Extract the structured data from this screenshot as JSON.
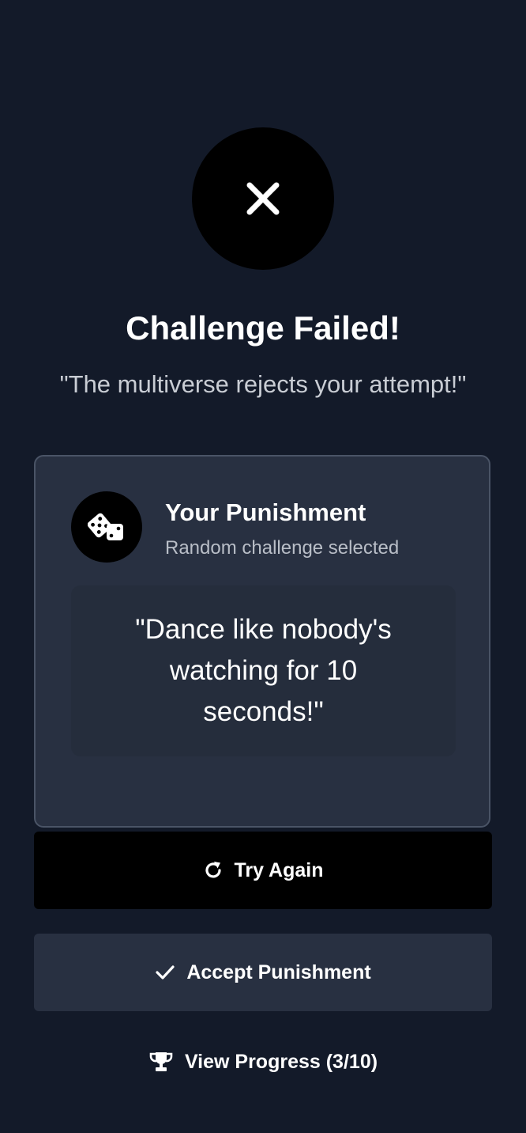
{
  "header": {
    "status_icon": "x-icon",
    "title": "Challenge Failed!",
    "subtitle": "\"The multiverse rejects your attempt!\""
  },
  "punishment_card": {
    "icon": "dice-icon",
    "title": "Your Punishment",
    "subtitle": "Random challenge selected",
    "challenge": "\"Dance like nobody's watching for 10 seconds!\""
  },
  "actions": {
    "try_again": {
      "label": "Try Again",
      "icon": "refresh-icon"
    },
    "accept": {
      "label": "Accept Punishment",
      "icon": "check-icon"
    },
    "progress": {
      "label": "View Progress (3/10)",
      "icon": "trophy-icon"
    }
  },
  "colors": {
    "background": "#131a29",
    "card": "#283041",
    "card_border": "#4a5466",
    "primary_button": "#000000",
    "secondary_button": "#283041",
    "text": "#ffffff",
    "muted_text": "#c9cdd4"
  }
}
